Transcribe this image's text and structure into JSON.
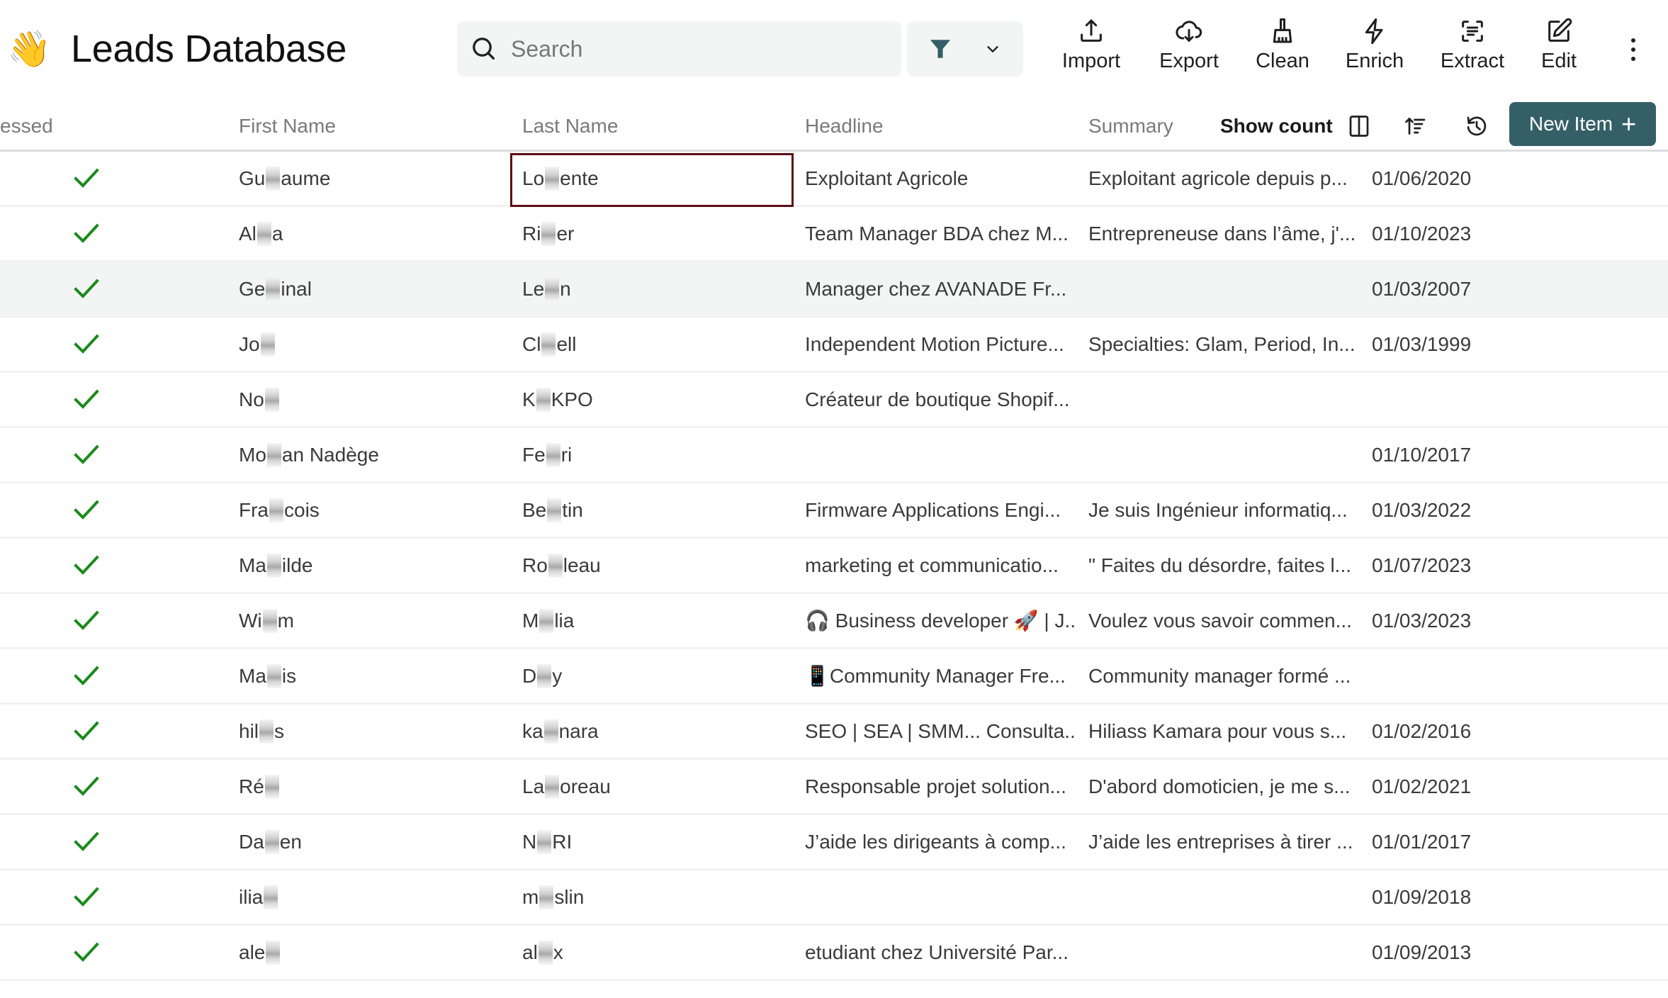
{
  "header": {
    "emoji": "👋",
    "title": "Leads Database"
  },
  "search": {
    "placeholder": "Search",
    "value": ""
  },
  "filter": {
    "icon": "filter-icon",
    "dropdown_icon": "chevron-down-icon",
    "accent_color": "#355f67"
  },
  "toolbar": {
    "buttons": [
      {
        "label": "Import",
        "icon": "upload-icon"
      },
      {
        "label": "Export",
        "icon": "cloud-download-icon"
      },
      {
        "label": "Clean",
        "icon": "broom-icon"
      },
      {
        "label": "Enrich",
        "icon": "lightning-icon"
      },
      {
        "label": "Extract",
        "icon": "scan-text-icon"
      },
      {
        "label": "Edit",
        "icon": "edit-icon"
      }
    ],
    "more_icon": "more-vertical-icon"
  },
  "table": {
    "columns": [
      "essed",
      "First Name",
      "Last Name",
      "Headline",
      "Summary"
    ],
    "show_count_label": "Show count",
    "header_icons": [
      "columns-icon",
      "sort-icon",
      "history-icon"
    ],
    "new_item_label": "New Item",
    "new_item_icon": "+",
    "selected_cell": {
      "row": 0,
      "column": "Last Name"
    },
    "highlighted_row": 2,
    "check_color": "#1a8a1a",
    "rows": [
      {
        "processed": true,
        "first": [
          "Gu",
          "aume"
        ],
        "last": [
          "Lo",
          "ente"
        ],
        "headline": "Exploitant Agricole",
        "summary": "Exploitant agricole depuis p...",
        "date": "01/06/2020"
      },
      {
        "processed": true,
        "first": [
          "Al",
          "a"
        ],
        "last": [
          "Ri",
          "er"
        ],
        "headline": "Team Manager BDA chez M...",
        "summary": "Entrepreneuse dans l’âme, j'...",
        "date": "01/10/2023"
      },
      {
        "processed": true,
        "first": [
          "Ge",
          "inal"
        ],
        "last": [
          "Le",
          "n"
        ],
        "headline": "Manager chez AVANADE Fr...",
        "summary": "",
        "date": "01/03/2007"
      },
      {
        "processed": true,
        "first": [
          "Jo",
          ""
        ],
        "last": [
          "Cl",
          "ell"
        ],
        "headline": "Independent Motion Picture...",
        "summary": "Specialties: Glam, Period, In...",
        "date": "01/03/1999"
      },
      {
        "processed": true,
        "first": [
          "No",
          ""
        ],
        "last": [
          "K",
          "KPO"
        ],
        "headline": "Créateur de boutique Shopif...",
        "summary": "",
        "date": ""
      },
      {
        "processed": true,
        "first": [
          "Mo",
          "an Nadège"
        ],
        "last": [
          "Fe",
          "ri"
        ],
        "headline": "",
        "summary": "",
        "date": "01/10/2017"
      },
      {
        "processed": true,
        "first": [
          "Fra",
          "cois"
        ],
        "last": [
          "Be",
          "tin"
        ],
        "headline": "Firmware Applications Engi...",
        "summary": "Je suis Ingénieur informatiq...",
        "date": "01/03/2022"
      },
      {
        "processed": true,
        "first": [
          "Ma",
          "ilde"
        ],
        "last": [
          "Ro",
          "leau"
        ],
        "headline": "marketing et communicatio...",
        "summary": "\" Faites du désordre, faites l...",
        "date": "01/07/2023"
      },
      {
        "processed": true,
        "first": [
          "Wi",
          "m"
        ],
        "last": [
          "M",
          "lia"
        ],
        "headline": "🎧 Business developer 🚀 | J...",
        "summary": "Voulez vous savoir commen...",
        "date": "01/03/2023"
      },
      {
        "processed": true,
        "first": [
          "Ma",
          "is"
        ],
        "last": [
          "D",
          "y"
        ],
        "headline": "📱Community Manager Fre...",
        "summary": "Community manager formé ...",
        "date": ""
      },
      {
        "processed": true,
        "first": [
          "hil",
          "s"
        ],
        "last": [
          "ka",
          "nara"
        ],
        "headline": "SEO | SEA | SMM... Consulta...",
        "summary": "Hiliass Kamara pour vous s...",
        "date": "01/02/2016"
      },
      {
        "processed": true,
        "first": [
          "Ré",
          ""
        ],
        "last": [
          "La",
          "oreau"
        ],
        "headline": "Responsable projet solution...",
        "summary": "D'abord domoticien, je me s...",
        "date": "01/02/2021"
      },
      {
        "processed": true,
        "first": [
          "Da",
          "en"
        ],
        "last": [
          "N",
          "RI"
        ],
        "headline": "J’aide les dirigeants à comp...",
        "summary": "J’aide les entreprises à tirer ...",
        "date": "01/01/2017"
      },
      {
        "processed": true,
        "first": [
          "ilia",
          ""
        ],
        "last": [
          "m",
          "slin"
        ],
        "headline": "",
        "summary": "",
        "date": "01/09/2018"
      },
      {
        "processed": true,
        "first": [
          "ale",
          ""
        ],
        "last": [
          "al",
          "x"
        ],
        "headline": "etudiant chez Université Par...",
        "summary": "",
        "date": "01/09/2013"
      }
    ]
  }
}
